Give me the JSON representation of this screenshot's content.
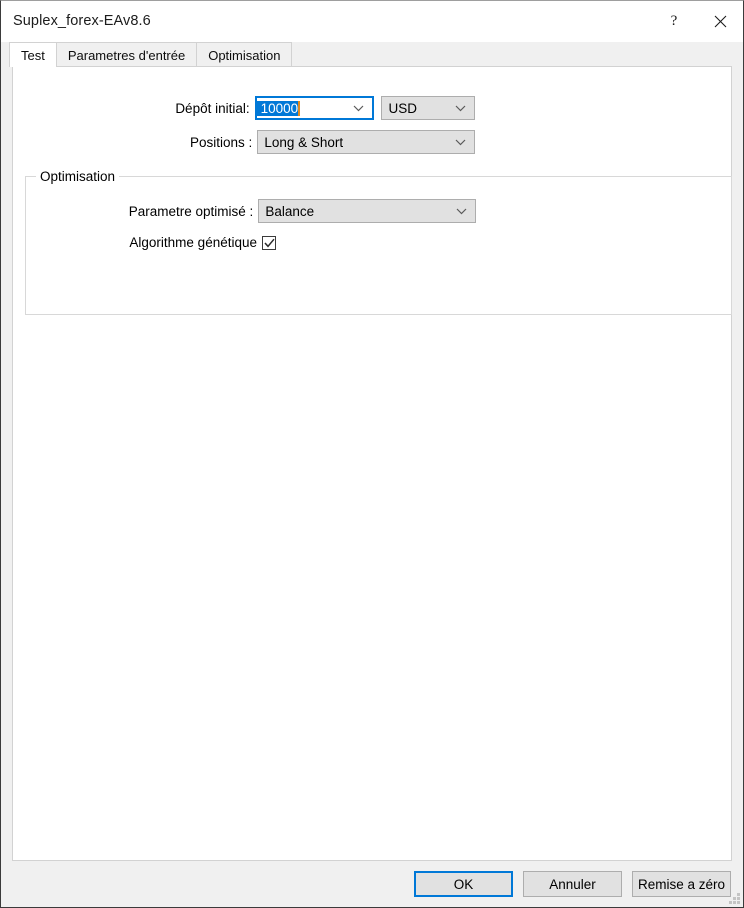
{
  "window": {
    "title": "Suplex_forex-EAv8.6",
    "help_button": "?",
    "close_button": "×",
    "help_icon_name": "help-icon",
    "close_icon_name": "close-icon"
  },
  "tabs": [
    {
      "label": "Test",
      "selected": true
    },
    {
      "label": "Parametres d'entrée",
      "selected": false
    },
    {
      "label": "Optimisation",
      "selected": false
    }
  ],
  "form": {
    "deposit": {
      "label": "Dépôt initial:",
      "value": "10000",
      "selected": true
    },
    "currency": {
      "label": "",
      "value": "USD"
    },
    "positions": {
      "label": "Positions :",
      "value": "Long & Short"
    }
  },
  "optimisation_group": {
    "title": "Optimisation",
    "parameter": {
      "label": "Parametre optimisé :",
      "value": "Balance"
    },
    "genetic": {
      "label": "Algorithme génétique",
      "checked": true,
      "check_glyph": "✓"
    }
  },
  "footer": {
    "ok_label": "OK",
    "cancel_label": "Annuler",
    "reset_label": "Remise a zéro"
  },
  "colors": {
    "accent": "#0078d7",
    "window_bg": "#f0f0f0",
    "panel_bg": "#ffffff",
    "control_bg": "#e1e1e1",
    "control_border": "#adadad",
    "selection": "#0078d7",
    "caret": "#e08a1e"
  }
}
